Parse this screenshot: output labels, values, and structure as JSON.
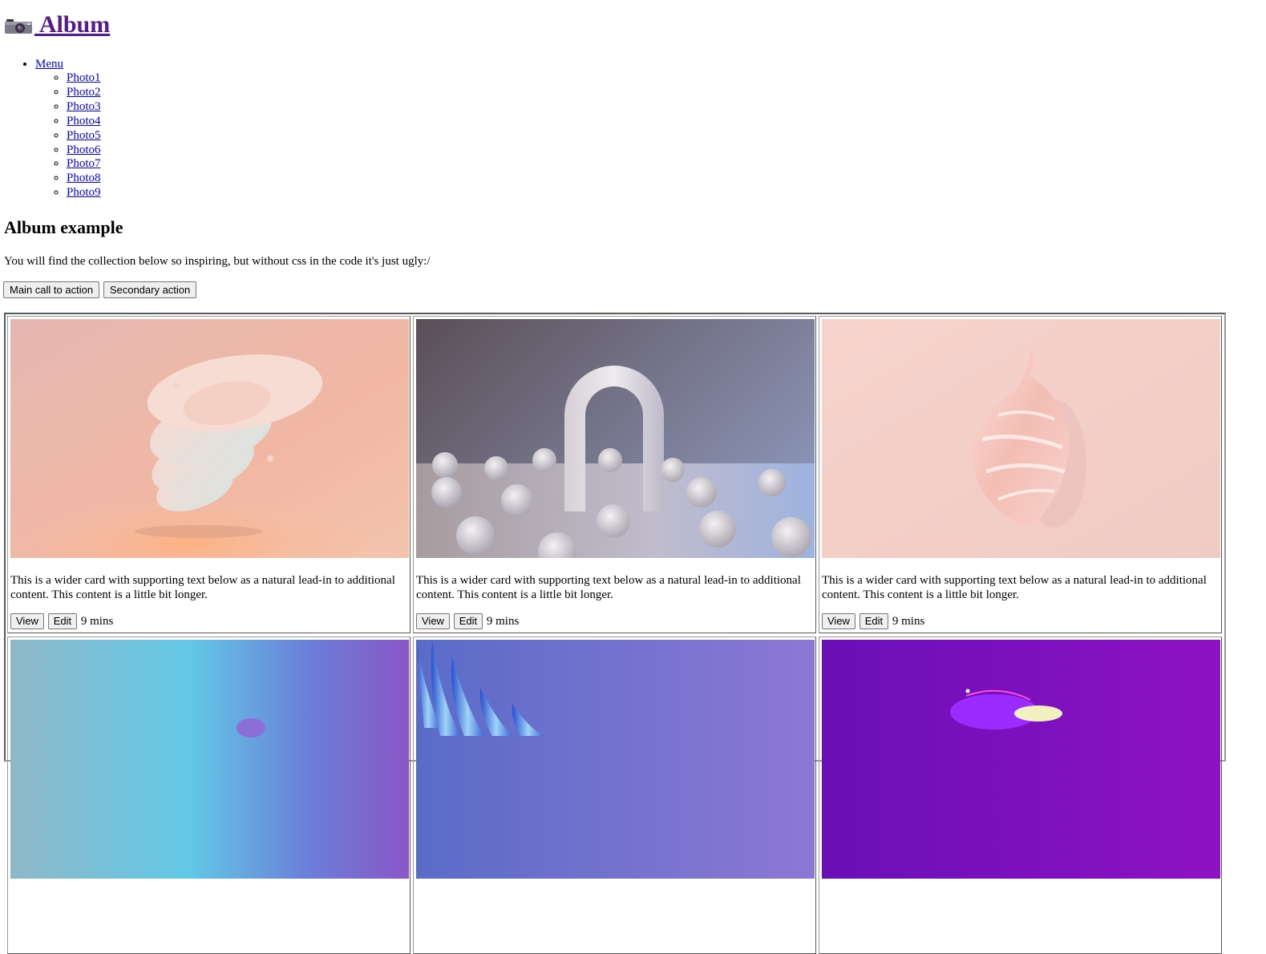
{
  "header": {
    "title": " Album",
    "icon": "camera-icon"
  },
  "menu": {
    "label": "Menu",
    "items": [
      "Photo1",
      "Photo2",
      "Photo3",
      "Photo4",
      "Photo5",
      "Photo6",
      "Photo7",
      "Photo8",
      "Photo9"
    ]
  },
  "hero": {
    "heading": "Album example",
    "lead": "You will find the collection below so inspiring, but without css in the code it's just ugly:/",
    "primary_label": "Main call to action",
    "secondary_label": "Secondary action"
  },
  "cards": [
    {
      "text": "This is a wider card with supporting text below as a natural lead-in to additional content. This content is a little bit longer.",
      "view_label": "View",
      "edit_label": "Edit",
      "time": "9 mins"
    },
    {
      "text": "This is a wider card with supporting text below as a natural lead-in to additional content. This content is a little bit longer.",
      "view_label": "View",
      "edit_label": "Edit",
      "time": "9 mins"
    },
    {
      "text": "This is a wider card with supporting text below as a natural lead-in to additional content. This content is a little bit longer.",
      "view_label": "View",
      "edit_label": "Edit",
      "time": "9 mins"
    },
    {
      "text": "",
      "view_label": "",
      "edit_label": "",
      "time": ""
    },
    {
      "text": "",
      "view_label": "",
      "edit_label": "",
      "time": ""
    },
    {
      "text": "",
      "view_label": "",
      "edit_label": "",
      "time": ""
    }
  ],
  "colors": {
    "link": "#0000ee",
    "visited_link": "#551a8b",
    "button_bg": "#efefef",
    "button_border": "#767676"
  }
}
